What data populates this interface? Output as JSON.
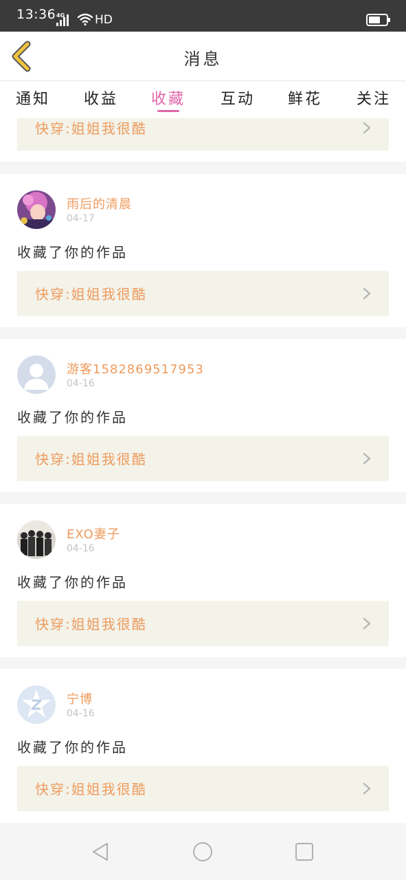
{
  "status_bar": {
    "time": "13:36",
    "network": "4G",
    "hd": "HD",
    "battery_level": 0.65
  },
  "header": {
    "title": "消息",
    "back_icon": "chevron-left-icon"
  },
  "tabs": [
    {
      "label": "通知",
      "active": false
    },
    {
      "label": "收益",
      "active": false
    },
    {
      "label": "收藏",
      "active": true
    },
    {
      "label": "互动",
      "active": false
    },
    {
      "label": "鲜花",
      "active": false
    },
    {
      "label": "关注",
      "active": false
    }
  ],
  "partial_card": {
    "work_title": "快穿:姐姐我很酷"
  },
  "messages": [
    {
      "username": "雨后的清晨",
      "date": "04-17",
      "text": "收藏了你的作品",
      "work_title": "快穿:姐姐我很酷",
      "avatar": "anime-avatar"
    },
    {
      "username": "游客1582869517953",
      "date": "04-16",
      "text": "收藏了你的作品",
      "work_title": "快穿:姐姐我很酷",
      "avatar": "default-user-avatar"
    },
    {
      "username": "EXO妻子",
      "date": "04-16",
      "text": "收藏了你的作品",
      "work_title": "快穿:姐姐我很酷",
      "avatar": "group-photo-avatar"
    },
    {
      "username": "宁博",
      "date": "04-16",
      "text": "收藏了你的作品",
      "work_title": "快穿:姐姐我很酷",
      "avatar": "qq-logo-avatar"
    }
  ],
  "colors": {
    "accent": "#e266a8",
    "work_text": "#ee9b5e",
    "work_bg": "#f3f3ea",
    "back_icon": "#f0c43f"
  },
  "nav_bar": {
    "back": "triangle-back-icon",
    "home": "circle-home-icon",
    "recents": "square-recents-icon"
  }
}
